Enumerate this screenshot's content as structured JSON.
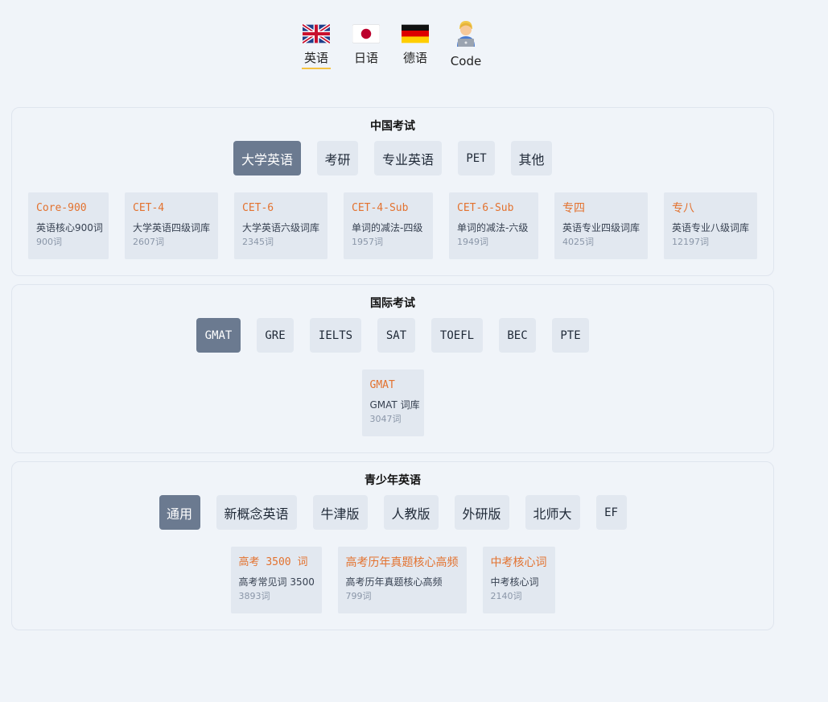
{
  "languages": [
    {
      "label": "英语",
      "icon": "uk-flag-icon",
      "active": true
    },
    {
      "label": "日语",
      "icon": "japan-flag-icon",
      "active": false
    },
    {
      "label": "德语",
      "icon": "germany-flag-icon",
      "active": false
    },
    {
      "label": "Code",
      "icon": "technologist-icon",
      "active": false
    }
  ],
  "sections": [
    {
      "title": "中国考试",
      "tabs": [
        "大学英语",
        "考研",
        "专业英语",
        "PET",
        "其他"
      ],
      "active_tab": "大学英语",
      "cards": [
        {
          "name": "Core-900",
          "desc": "英语核心900词",
          "count": "900词"
        },
        {
          "name": "CET-4",
          "desc": "大学英语四级词库",
          "count": "2607词"
        },
        {
          "name": "CET-6",
          "desc": "大学英语六级词库",
          "count": "2345词"
        },
        {
          "name": "CET-4-Sub",
          "desc": "单词的减法-四级",
          "count": "1957词"
        },
        {
          "name": "CET-6-Sub",
          "desc": "单词的减法-六级",
          "count": "1949词"
        },
        {
          "name": "专四",
          "desc": "英语专业四级词库",
          "count": "4025词"
        },
        {
          "name": "专八",
          "desc": "英语专业八级词库",
          "count": "12197词"
        }
      ]
    },
    {
      "title": "国际考试",
      "tabs": [
        "GMAT",
        "GRE",
        "IELTS",
        "SAT",
        "TOEFL",
        "BEC",
        "PTE"
      ],
      "active_tab": "GMAT",
      "cards": [
        {
          "name": "GMAT",
          "desc": "GMAT 词库",
          "count": "3047词"
        }
      ]
    },
    {
      "title": "青少年英语",
      "tabs": [
        "通用",
        "新概念英语",
        "牛津版",
        "人教版",
        "外研版",
        "北师大",
        "EF"
      ],
      "active_tab": "通用",
      "cards": [
        {
          "name": "高考 3500 词",
          "desc": "高考常见词 3500",
          "count": "3893词"
        },
        {
          "name": "高考历年真题核心高频",
          "desc": "高考历年真题核心高频",
          "count": "799词"
        },
        {
          "name": "中考核心词",
          "desc": "中考核心词",
          "count": "2140词"
        }
      ]
    }
  ],
  "colors": {
    "background": "#f0f4f9",
    "tab_bg": "#e2e8f0",
    "tab_active_bg": "#6b7a90",
    "card_title": "#e3722f",
    "underline": "#f5c342"
  }
}
